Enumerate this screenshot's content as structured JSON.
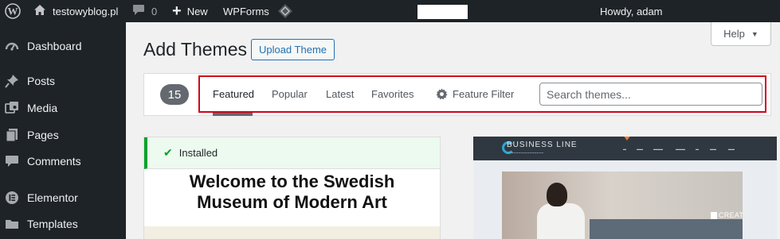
{
  "admin_bar": {
    "site_name": "testowyblog.pl",
    "comments_count": "0",
    "new_label": "New",
    "wpforms_label": "WPForms",
    "howdy": "Howdy, adam"
  },
  "sidebar": {
    "items": [
      {
        "label": "Dashboard",
        "icon": "dashboard-icon"
      },
      {
        "label": "Posts",
        "icon": "pin-icon"
      },
      {
        "label": "Media",
        "icon": "media-icon"
      },
      {
        "label": "Pages",
        "icon": "pages-icon"
      },
      {
        "label": "Comments",
        "icon": "comment-icon"
      },
      {
        "label": "Elementor",
        "icon": "elementor-icon"
      },
      {
        "label": "Templates",
        "icon": "folder-icon"
      }
    ]
  },
  "header": {
    "title": "Add Themes",
    "upload_label": "Upload Theme",
    "help_label": "Help"
  },
  "filter": {
    "count": "15",
    "tabs": [
      "Featured",
      "Popular",
      "Latest",
      "Favorites"
    ],
    "current_tab": "Featured",
    "feature_filter_label": "Feature Filter",
    "search_placeholder": "Search themes..."
  },
  "themes": [
    {
      "status": "Installed",
      "preview_heading_line1": "Welcome to the Swedish",
      "preview_heading_line2": "Museum of Modern Art"
    },
    {
      "preview_logo": "BUSINESS LINE",
      "preview_badge": "CREATION"
    }
  ],
  "colors": {
    "admin_bg": "#1d2327",
    "accent": "#2271b1",
    "installed_green": "#00a32a",
    "highlight_red": "#d0021b"
  }
}
